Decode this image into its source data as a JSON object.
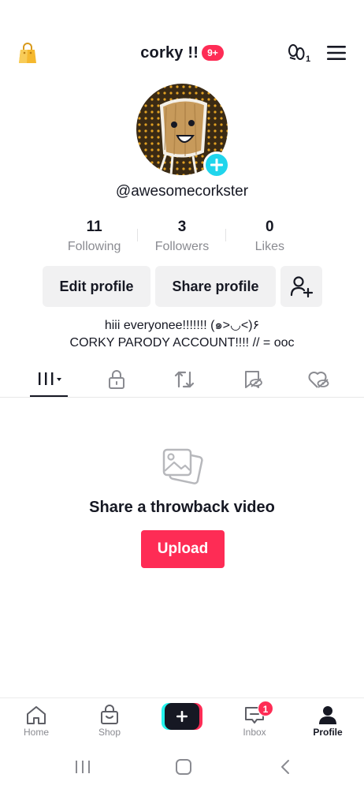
{
  "header": {
    "title": "corky !!",
    "notification_badge": "9+",
    "footprint_count": "1",
    "accent_color": "#fe2c55"
  },
  "profile": {
    "username": "@awesomecorkster",
    "stats": [
      {
        "value": "11",
        "label": "Following"
      },
      {
        "value": "3",
        "label": "Followers"
      },
      {
        "value": "0",
        "label": "Likes"
      }
    ],
    "actions": {
      "edit_label": "Edit profile",
      "share_label": "Share profile"
    },
    "bio_line1": "hiii everyonee!!!!!!! (๑>◡<)۶",
    "bio_line2": "CORKY PARODY ACCOUNT!!!! // = ooc"
  },
  "tabs": [
    {
      "icon": "videos-grid-icon",
      "active": true
    },
    {
      "icon": "lock-icon",
      "active": false
    },
    {
      "icon": "repost-icon",
      "active": false
    },
    {
      "icon": "favorites-icon",
      "active": false
    },
    {
      "icon": "liked-icon",
      "active": false
    }
  ],
  "empty_state": {
    "title": "Share a throwback video",
    "button_label": "Upload"
  },
  "bottom_nav": {
    "home": "Home",
    "shop": "Shop",
    "inbox": "Inbox",
    "inbox_badge": "1",
    "profile": "Profile"
  }
}
